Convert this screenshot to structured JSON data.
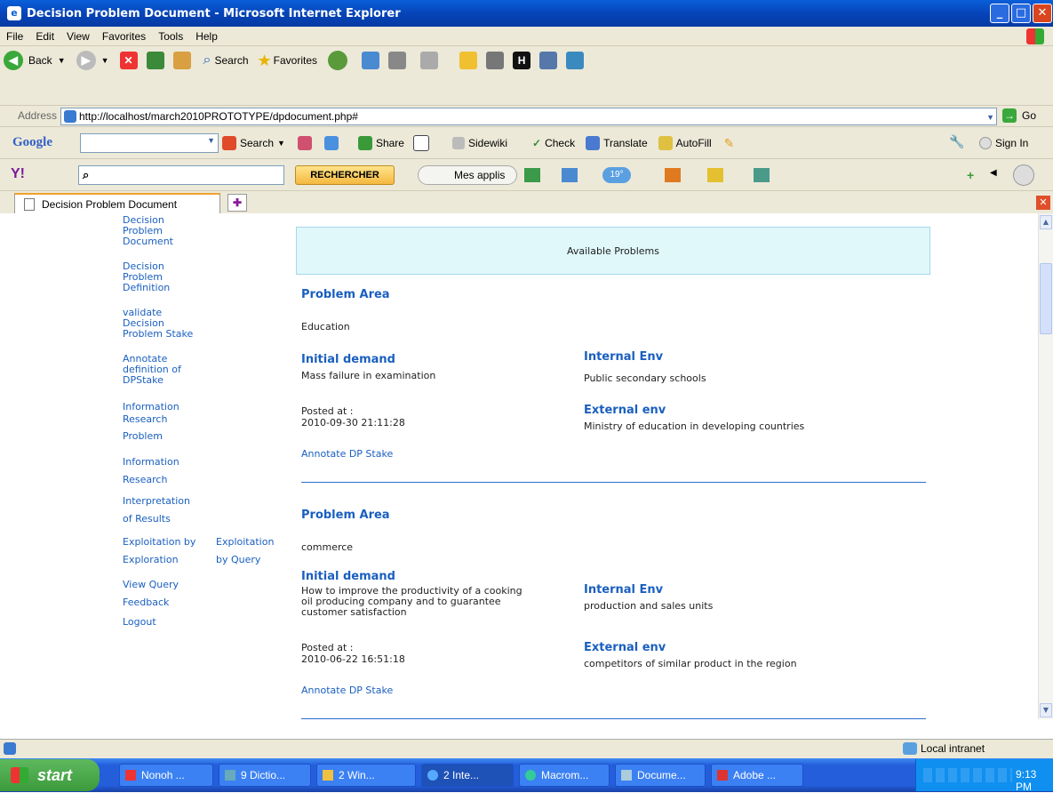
{
  "window": {
    "title": "Decision Problem Document - Microsoft Internet Explorer"
  },
  "menu": [
    "File",
    "Edit",
    "View",
    "Favorites",
    "Tools",
    "Help"
  ],
  "toolbar": {
    "back": "Back",
    "search": "Search",
    "favorites": "Favorites"
  },
  "address": {
    "label": "Address",
    "url": "http://localhost/march2010PROTOTYPE/dpdocument.php#",
    "go": "Go"
  },
  "google": {
    "logo": "Google",
    "search": "Search",
    "share": "Share",
    "sidewiki": "Sidewiki",
    "check": "Check",
    "translate": "Translate",
    "autofill": "AutoFill",
    "signin": "Sign In"
  },
  "yahoo": {
    "logo": "Y!",
    "button": "RECHERCHER",
    "apps": "Mes applis",
    "weather": "19°"
  },
  "tab": {
    "title": "Decision Problem Document"
  },
  "nav": {
    "i1": [
      "Decision",
      "Problem",
      "Document"
    ],
    "i2": [
      "Decision",
      "Problem",
      "Definition"
    ],
    "i3": [
      "validate",
      "Decision",
      "Problem Stake"
    ],
    "i4": [
      "Annotate",
      "definition of",
      "DPStake"
    ],
    "i5": [
      "Information",
      "Research",
      "Problem"
    ],
    "i6": [
      "Information",
      "Research"
    ],
    "i7": [
      "Interpretation",
      "of Results"
    ],
    "i8a": [
      "Exploitation by",
      "Exploration"
    ],
    "i8b": [
      "Exploitation",
      "by Query"
    ],
    "i9": [
      "View Query",
      "Feedback"
    ],
    "i10": "Logout"
  },
  "main": {
    "banner": "Available Problems",
    "problems": [
      {
        "area_label": "Problem Area",
        "area": "Education",
        "demand_label": "Initial demand",
        "demand": [
          "Mass failure in examination"
        ],
        "internal_label": "Internal Env",
        "internal": "Public secondary schools",
        "posted_label": "Posted at :",
        "posted": "2010-09-30 21:11:28",
        "external_label": "External env",
        "external": "Ministry of education in developing countries",
        "annotate": "Annotate DP Stake"
      },
      {
        "area_label": "Problem Area",
        "area": "commerce",
        "demand_label": "Initial demand",
        "demand": [
          "How to improve the productivity of a cooking",
          "oil producing company and to guarantee",
          "customer satisfaction"
        ],
        "internal_label": "Internal Env",
        "internal": "production and sales units",
        "posted_label": "Posted at :",
        "posted": "2010-06-22 16:51:18",
        "external_label": "External env",
        "external": "competitors of similar product in the region",
        "annotate": "Annotate DP Stake"
      }
    ]
  },
  "status": {
    "zone": "Local intranet"
  },
  "taskbar": {
    "start": "start",
    "tasks": [
      "Nonoh ...",
      "9 Dictio...",
      "2 Win...",
      "2 Inte...",
      "Macrom...",
      "Docume...",
      "Adobe ..."
    ],
    "clock": "9:13 PM"
  },
  "colors": {
    "link": "#1a5fbf",
    "banner": "#e0f8fa",
    "titlebar": "#0a5fd9"
  }
}
